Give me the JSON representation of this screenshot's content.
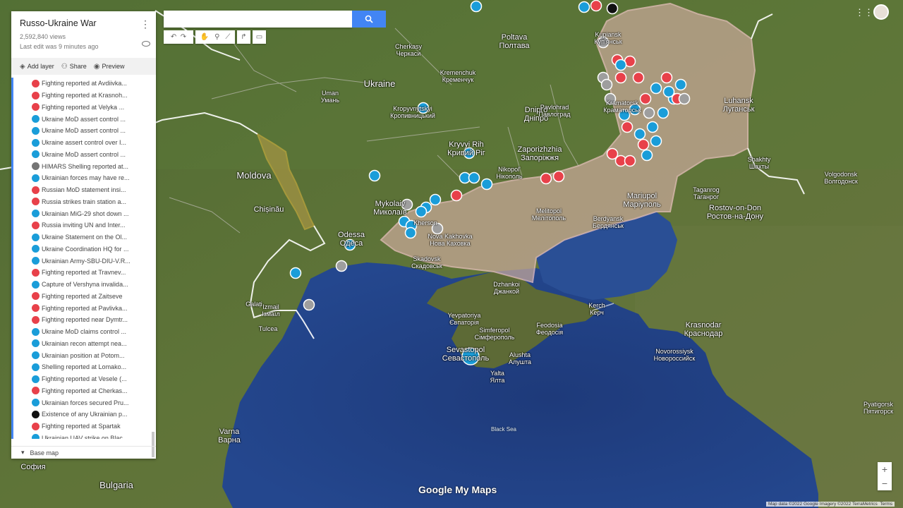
{
  "panel": {
    "title": "Russo-Ukraine War",
    "views": "2,592,840 views",
    "last_edit": "Last edit was 9 minutes ago",
    "toolbar": {
      "add_layer": "Add layer",
      "share": "Share",
      "preview": "Preview"
    },
    "base_map": "Base map",
    "items": [
      {
        "label": "Fighting reported at Avdiivka...",
        "color": "#e8414a",
        "icon": "crossed-swords-icon"
      },
      {
        "label": "Fighting reported at Krasnoh...",
        "color": "#e8414a",
        "icon": "crossed-swords-icon"
      },
      {
        "label": "Fighting reported at Velyka ...",
        "color": "#e8414a",
        "icon": "crossed-swords-icon"
      },
      {
        "label": "Ukraine MoD assert control ...",
        "color": "#1a9dd9",
        "icon": "question-icon"
      },
      {
        "label": "Ukraine MoD assert control ...",
        "color": "#1a9dd9",
        "icon": "question-icon"
      },
      {
        "label": "Ukraine assert control over I...",
        "color": "#1a9dd9",
        "icon": "question-icon"
      },
      {
        "label": "Ukraine MoD assert control ...",
        "color": "#1a9dd9",
        "icon": "question-icon"
      },
      {
        "label": "HIMARS Shelling reported at...",
        "color": "#757575",
        "icon": "explosion-icon"
      },
      {
        "label": "Ukrainian forces may have re...",
        "color": "#1a9dd9",
        "icon": "question-icon"
      },
      {
        "label": "Russian MoD statement insi...",
        "color": "#e8414a",
        "icon": "megaphone-icon"
      },
      {
        "label": "Russia strikes train station a...",
        "color": "#e8414a",
        "icon": "train-icon"
      },
      {
        "label": "Ukrainian MiG-29 shot down ...",
        "color": "#1a9dd9",
        "icon": "plane-icon"
      },
      {
        "label": "Russia inviting UN and Inter...",
        "color": "#e8414a",
        "icon": "warning-icon"
      },
      {
        "label": "Ukraine Statement on the Ol...",
        "color": "#1a9dd9",
        "icon": "megaphone-icon"
      },
      {
        "label": "Ukraine Coordination HQ for ...",
        "color": "#1a9dd9",
        "icon": "megaphone-icon"
      },
      {
        "label": "Ukrainian Army-SBU-DIU-V.R...",
        "color": "#1a9dd9",
        "icon": "megaphone-icon"
      },
      {
        "label": "Fighting reported at Travnev...",
        "color": "#e8414a",
        "icon": "crossed-swords-icon"
      },
      {
        "label": "Capture of Vershyna invalida...",
        "color": "#1a9dd9",
        "icon": "flag-icon"
      },
      {
        "label": "Fighting reported at Zaitseve",
        "color": "#e8414a",
        "icon": "crossed-swords-icon"
      },
      {
        "label": "Fighting reported at Pavlivka...",
        "color": "#e8414a",
        "icon": "crossed-swords-icon"
      },
      {
        "label": "Fighting reported near Dymtr...",
        "color": "#e8414a",
        "icon": "crossed-swords-icon"
      },
      {
        "label": "Ukraine MoD claims control ...",
        "color": "#1a9dd9",
        "icon": "question-icon"
      },
      {
        "label": "Ukrainian recon attempt nea...",
        "color": "#1a9dd9",
        "icon": "walker-icon"
      },
      {
        "label": "Ukrainian position at Potom...",
        "color": "#1a9dd9",
        "icon": "flag-icon"
      },
      {
        "label": "Shelling reported at Lomako...",
        "color": "#1a9dd9",
        "icon": "crossed-swords-icon"
      },
      {
        "label": "Fighting reported at Vesele (...",
        "color": "#1a9dd9",
        "icon": "crossed-swords-icon"
      },
      {
        "label": "Fighting reported at Cherkas...",
        "color": "#e8414a",
        "icon": "crossed-swords-icon"
      },
      {
        "label": "Ukrainian forces secured Pru...",
        "color": "#1a9dd9",
        "icon": "walker-icon"
      },
      {
        "label": "Existence of any Ukrainian p...",
        "color": "#111111",
        "icon": "triangle-icon"
      },
      {
        "label": "Fighting reported at Spartak",
        "color": "#e8414a",
        "icon": "crossed-swords-icon"
      },
      {
        "label": "Ukrainian UAV strike on Blac...",
        "color": "#1a9dd9",
        "icon": "drone-icon"
      }
    ]
  },
  "map": {
    "attribution": "Map data ©2022 Google Imagery ©2022 TerraMetrics",
    "terms": "Terms",
    "logo": "Google My Maps",
    "labels": [
      {
        "text": "Ukraine",
        "size": "big"
      },
      {
        "text": "Moldova",
        "size": "big"
      },
      {
        "text": "Bulgaria",
        "size": "big"
      },
      {
        "text": "Poltava\nПолтава",
        "size": "med"
      },
      {
        "text": "Cherkasy\nЧеркаси",
        "size": "sm"
      },
      {
        "text": "Kremenchuk\nКременчук",
        "size": "sm"
      },
      {
        "text": "Dnipro\nДніпро",
        "size": "med"
      },
      {
        "text": "Pavlohrad\nПавлоград",
        "size": "sm"
      },
      {
        "text": "Kryvyi Rih\nКривий Ріг",
        "size": "med"
      },
      {
        "text": "Zaporizhzhia\nЗапоріжжя",
        "size": "med"
      },
      {
        "text": "Nikopol'\nНікополь",
        "size": "sm"
      },
      {
        "text": "Mykolaiv\nМиколаїв",
        "size": "med"
      },
      {
        "text": "Odessa\nОдеса",
        "size": "med"
      },
      {
        "text": "Chișinău",
        "size": "med"
      },
      {
        "text": "Uman\nУмань",
        "size": "sm"
      },
      {
        "text": "Kropyvnytskyi\nКропивницький",
        "size": "sm"
      },
      {
        "text": "Mariupol\nМаріуполь",
        "size": "med"
      },
      {
        "text": "Melitopol\nМелітополь",
        "size": "sm"
      },
      {
        "text": "Berdyansk\nБердянськ",
        "size": "sm"
      },
      {
        "text": "Luhansk\nЛуганськ",
        "size": "med"
      },
      {
        "text": "Rostov-on-Don\nРостов-на-Дону",
        "size": "med"
      },
      {
        "text": "Krasnodar\nКраснодар",
        "size": "med"
      },
      {
        "text": "Simferopol\nСімферополь",
        "size": "sm"
      },
      {
        "text": "Sevastopol\nСевастополь",
        "size": "med"
      },
      {
        "text": "Yevpatoriya\nЄвпаторія",
        "size": "sm"
      },
      {
        "text": "Kerch\nКерч",
        "size": "sm"
      },
      {
        "text": "Feodosia\nФеодосія",
        "size": "sm"
      },
      {
        "text": "Novorossiysk\nНовороссийск",
        "size": "sm"
      },
      {
        "text": "Varna\nВарна",
        "size": "med"
      },
      {
        "text": "София",
        "size": "med"
      },
      {
        "text": "Nova Kakhovka\nНова Каховка",
        "size": "sm"
      },
      {
        "text": "Kherson",
        "size": "sm"
      },
      {
        "text": "Skadovsk\nСкадовськ",
        "size": "sm"
      },
      {
        "text": "Dzhankoi\nДжанкой",
        "size": "sm"
      },
      {
        "text": "Yalta\nЯлта",
        "size": "sm"
      },
      {
        "text": "Alushta\nАлушта",
        "size": "sm"
      },
      {
        "text": "Izmail\nІзмаїл",
        "size": "sm"
      },
      {
        "text": "Galați",
        "size": "sm"
      },
      {
        "text": "Tulcea",
        "size": "sm"
      },
      {
        "text": "Kupiansk\nКуп'янськ",
        "size": "sm"
      },
      {
        "text": "Kramatorsk\nКраматорськ",
        "size": "sm"
      },
      {
        "text": "Taganrog\nТаганрог",
        "size": "sm"
      },
      {
        "text": "Shakhty\nШахты",
        "size": "sm"
      },
      {
        "text": "Volgodonsk\nВолгодонск",
        "size": "sm"
      },
      {
        "text": "Pyatigorsk\nПятигорск",
        "size": "sm"
      },
      {
        "text": "Black Sea",
        "size": "sea"
      }
    ]
  }
}
